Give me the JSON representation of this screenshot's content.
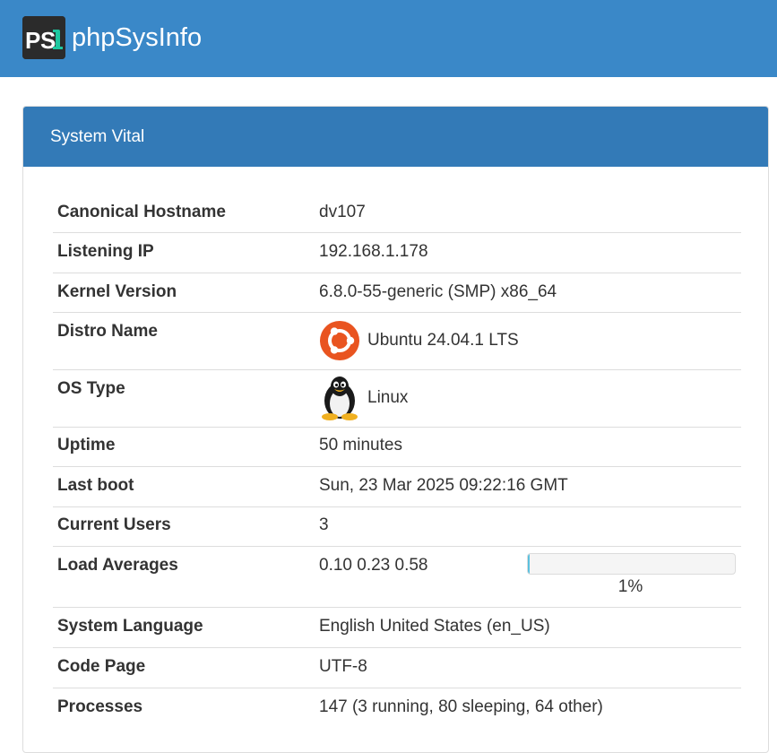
{
  "header": {
    "app_title": "phpSysInfo",
    "logo_text": "PSI",
    "colors": {
      "topbar": "#3a88c8",
      "panel_heading": "#337ab7"
    }
  },
  "panel": {
    "title": "System Vital"
  },
  "vitals": {
    "hostname": {
      "label": "Canonical Hostname",
      "value": "dv107"
    },
    "ip": {
      "label": "Listening IP",
      "value": "192.168.1.178"
    },
    "kernel": {
      "label": "Kernel Version",
      "value": "6.8.0-55-generic (SMP) x86_64"
    },
    "distro": {
      "label": "Distro Name",
      "value": "Ubuntu 24.04.1 LTS",
      "icon": "ubuntu-icon"
    },
    "ostype": {
      "label": "OS Type",
      "value": "Linux",
      "icon": "tux-penguin-icon"
    },
    "uptime": {
      "label": "Uptime",
      "value": "50 minutes"
    },
    "lastboot": {
      "label": "Last boot",
      "value": "Sun, 23 Mar 2025 09:22:16 GMT"
    },
    "users": {
      "label": "Current Users",
      "value": "3"
    },
    "load": {
      "label": "Load Averages",
      "value": "0.10 0.23 0.58",
      "percent_text": "1%",
      "percent": 1
    },
    "language": {
      "label": "System Language",
      "value": "English United States (en_US)"
    },
    "codepage": {
      "label": "Code Page",
      "value": "UTF-8"
    },
    "processes": {
      "label": "Processes",
      "value": "147 (3 running, 80 sleeping, 64 other)"
    }
  }
}
